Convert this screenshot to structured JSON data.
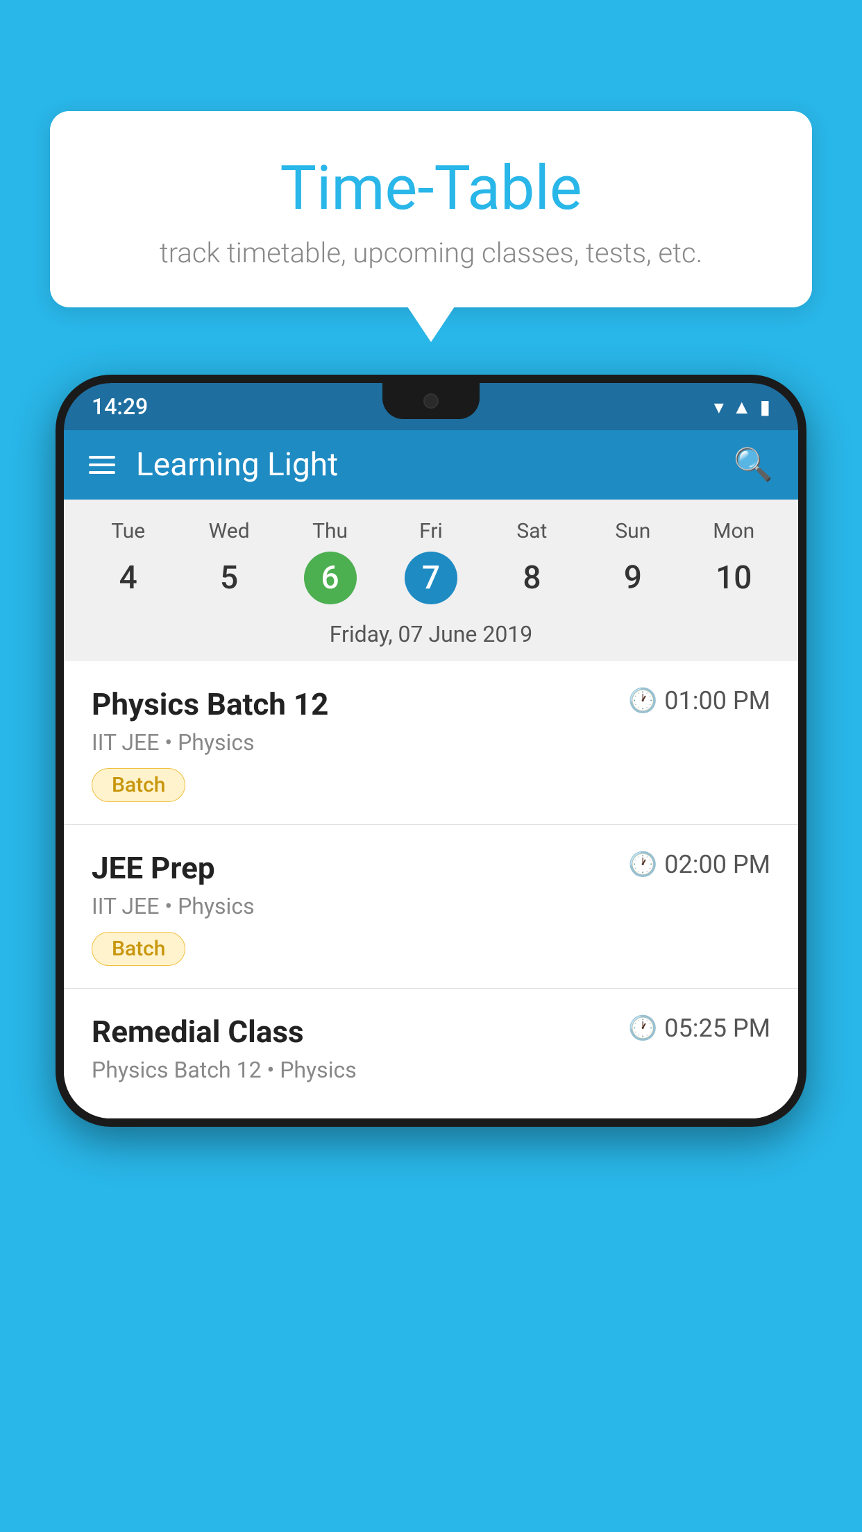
{
  "background": {
    "color": "#29B6E8"
  },
  "speech_bubble": {
    "title": "Time-Table",
    "subtitle": "track timetable, upcoming classes, tests, etc."
  },
  "phone": {
    "status_bar": {
      "time": "14:29"
    },
    "app_bar": {
      "title": "Learning Light"
    },
    "calendar": {
      "days": [
        {
          "name": "Tue",
          "number": "4",
          "state": "normal"
        },
        {
          "name": "Wed",
          "number": "5",
          "state": "normal"
        },
        {
          "name": "Thu",
          "number": "6",
          "state": "today"
        },
        {
          "name": "Fri",
          "number": "7",
          "state": "selected"
        },
        {
          "name": "Sat",
          "number": "8",
          "state": "normal"
        },
        {
          "name": "Sun",
          "number": "9",
          "state": "normal"
        },
        {
          "name": "Mon",
          "number": "10",
          "state": "normal"
        }
      ],
      "selected_date_label": "Friday, 07 June 2019"
    },
    "classes": [
      {
        "name": "Physics Batch 12",
        "time": "01:00 PM",
        "subject": "IIT JEE • Physics",
        "badge": "Batch"
      },
      {
        "name": "JEE Prep",
        "time": "02:00 PM",
        "subject": "IIT JEE • Physics",
        "badge": "Batch"
      },
      {
        "name": "Remedial Class",
        "time": "05:25 PM",
        "subject": "Physics Batch 12 • Physics",
        "badge": ""
      }
    ]
  }
}
